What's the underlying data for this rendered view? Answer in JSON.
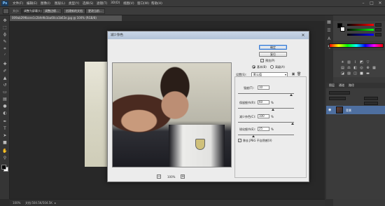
{
  "app": {
    "logo_text": "Ps"
  },
  "menubar": {
    "items": [
      "文件(F)",
      "编辑(E)",
      "图像(I)",
      "图层(L)",
      "类型(Y)",
      "选择(S)",
      "滤镜(T)",
      "3D(D)",
      "视图(V)",
      "窗口(W)",
      "帮助(H)"
    ]
  },
  "window_controls": {
    "minimize": "–",
    "maximize": "□",
    "close": "✕"
  },
  "options_bar": {
    "buttons": [
      "调整边缘...",
      "创建新的文档",
      "更改当前..."
    ],
    "field_label": "大小:",
    "dropdown": "100%",
    "field_value": "调整为屏幕大小"
  },
  "document_tab": {
    "label": "009ab299bcee1c2bfe9b1ba60ca1b63e.jpg @ 100% (RGB/8)"
  },
  "status_bar": {
    "zoom": "100%",
    "doc_size": "文档:504.5K/504.5K"
  },
  "layers_panel": {
    "tabs": [
      "图层",
      "通道",
      "路径"
    ],
    "layer_name": "背景"
  },
  "dialog": {
    "title": "减少杂色",
    "ok_label": "确定",
    "reset_label": "复位",
    "preview_checkbox_label": "预览(P)",
    "preview_checked": true,
    "mode_basic_label": "基本(B)",
    "mode_advanced_label": "高级(A)",
    "mode_selected": "basic",
    "settings_label": "设置(S):",
    "settings_value": "默认值",
    "zoom_level": "100%",
    "zoom_minus": "−",
    "zoom_plus": "+",
    "sliders": [
      {
        "label": "强度(T):",
        "value": "10",
        "unit": ""
      },
      {
        "label": "保留细节(R):",
        "value": "60",
        "unit": "%"
      },
      {
        "label": "减少杂色(C):",
        "value": "100",
        "unit": "%"
      },
      {
        "label": "锐化细节(E):",
        "value": "25",
        "unit": "%"
      }
    ],
    "slider_levels": [
      0.95,
      0.62,
      0.97,
      0.28
    ],
    "jpeg_checkbox_label": "移去 JPEG 不自然感(V)",
    "jpeg_checked": true
  },
  "colors": {
    "foreground": "#000000",
    "background": "#ffffff",
    "layer_selected": "#4e6fa0",
    "default_button_border": "#3b7bd1"
  },
  "icons": {
    "toolbox": [
      "move-icon",
      "marquee-icon",
      "lasso-icon",
      "quick-select-icon",
      "crop-icon",
      "eyedropper-icon",
      "healing-icon",
      "brush-icon",
      "stamp-icon",
      "history-brush-icon",
      "eraser-icon",
      "gradient-icon",
      "blur-icon",
      "dodge-icon",
      "pen-icon",
      "type-icon",
      "path-select-icon",
      "shape-icon",
      "hand-icon",
      "zoom-icon"
    ]
  }
}
